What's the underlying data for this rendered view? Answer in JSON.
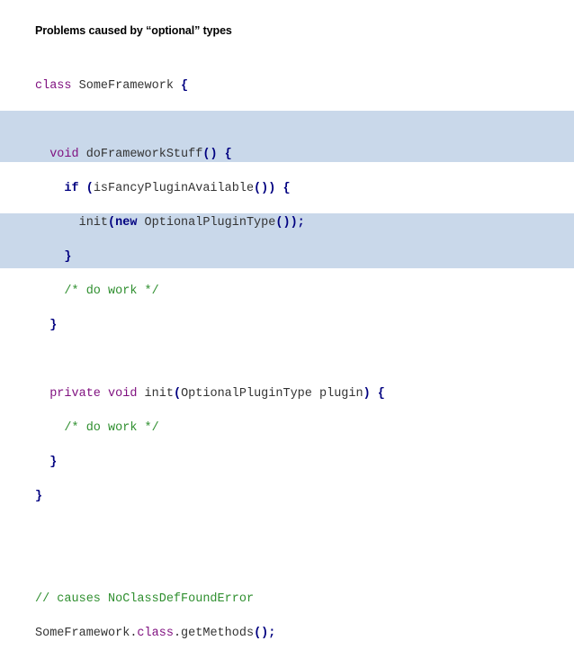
{
  "slide": {
    "title": "Problems caused by “optional” types"
  },
  "code": {
    "l1_kw": "class",
    "l1_name": " SomeFramework ",
    "l1_brace": "{",
    "l3_indent": "  ",
    "l3_kw": "void",
    "l3_name": " doFrameworkStuff",
    "l3_parens": "()",
    "l3_brace": " {",
    "l4_indent": "    ",
    "l4_kw": "if",
    "l4_open": " (",
    "l4_call": "isFancyPluginAvailable",
    "l4_close": "()) {",
    "l5_indent": "      ",
    "l5_call": "init",
    "l5_open": "(",
    "l5_new": "new",
    "l5_type": " OptionalPluginType",
    "l5_close": "());",
    "l6_indent": "    ",
    "l6_brace": "}",
    "l7_indent": "    ",
    "l7_comment": "/* do work */",
    "l8_indent": "  ",
    "l8_brace": "}",
    "l10_indent": "  ",
    "l10_kw1": "private",
    "l10_kw2": " void",
    "l10_name": " init",
    "l10_open": "(",
    "l10_params": "OptionalPluginType plugin",
    "l10_close": ") {",
    "l11_indent": "    ",
    "l11_comment": "/* do work */",
    "l12_indent": "  ",
    "l12_brace": "}",
    "l13_brace": "}",
    "l16_comment": "// causes NoClassDefFoundError",
    "l17_name": "SomeFramework.",
    "l17_kw": "class",
    "l17_call": ".getMethods",
    "l17_end": "();"
  },
  "colors": {
    "highlight": "#c9d8ea",
    "keyword": "#7f0f7f",
    "comment": "#2f8f2f",
    "punctuation": "#000080"
  }
}
